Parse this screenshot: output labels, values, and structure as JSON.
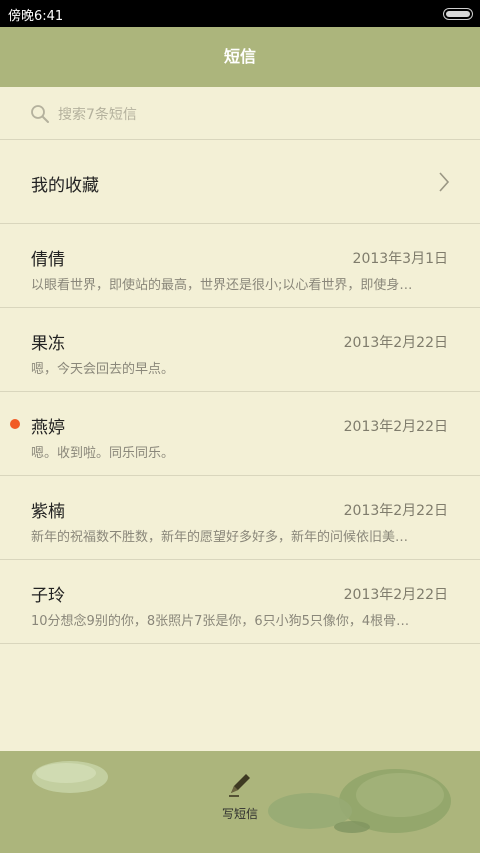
{
  "status_bar": {
    "time": "傍晚6:41"
  },
  "header": {
    "title": "短信"
  },
  "search": {
    "placeholder": "搜索7条短信"
  },
  "favorites": {
    "label": "我的收藏"
  },
  "conversations": [
    {
      "name": "倩倩",
      "date": "2013年3月1日",
      "preview": "以眼看世界，即使站的最高，世界还是很小;以心看世界，即使身…",
      "unread": false
    },
    {
      "name": "果冻",
      "date": "2013年2月22日",
      "preview": "嗯，今天会回去的早点。",
      "unread": false
    },
    {
      "name": "燕婷",
      "date": "2013年2月22日",
      "preview": "嗯。收到啦。同乐同乐。",
      "unread": true
    },
    {
      "name": "紫楠",
      "date": "2013年2月22日",
      "preview": "新年的祝福数不胜数，新年的愿望好多好多，新年的问候依旧美…",
      "unread": false
    },
    {
      "name": "子玲",
      "date": "2013年2月22日",
      "preview": "10分想念9别的你，8张照片7张是你，6只小狗5只像你，4根骨…",
      "unread": false
    }
  ],
  "bottom_bar": {
    "compose_label": "写短信"
  },
  "colors": {
    "header_bg": "#acb57c",
    "list_bg": "#f3f0d6",
    "unread_dot": "#f15a24"
  }
}
